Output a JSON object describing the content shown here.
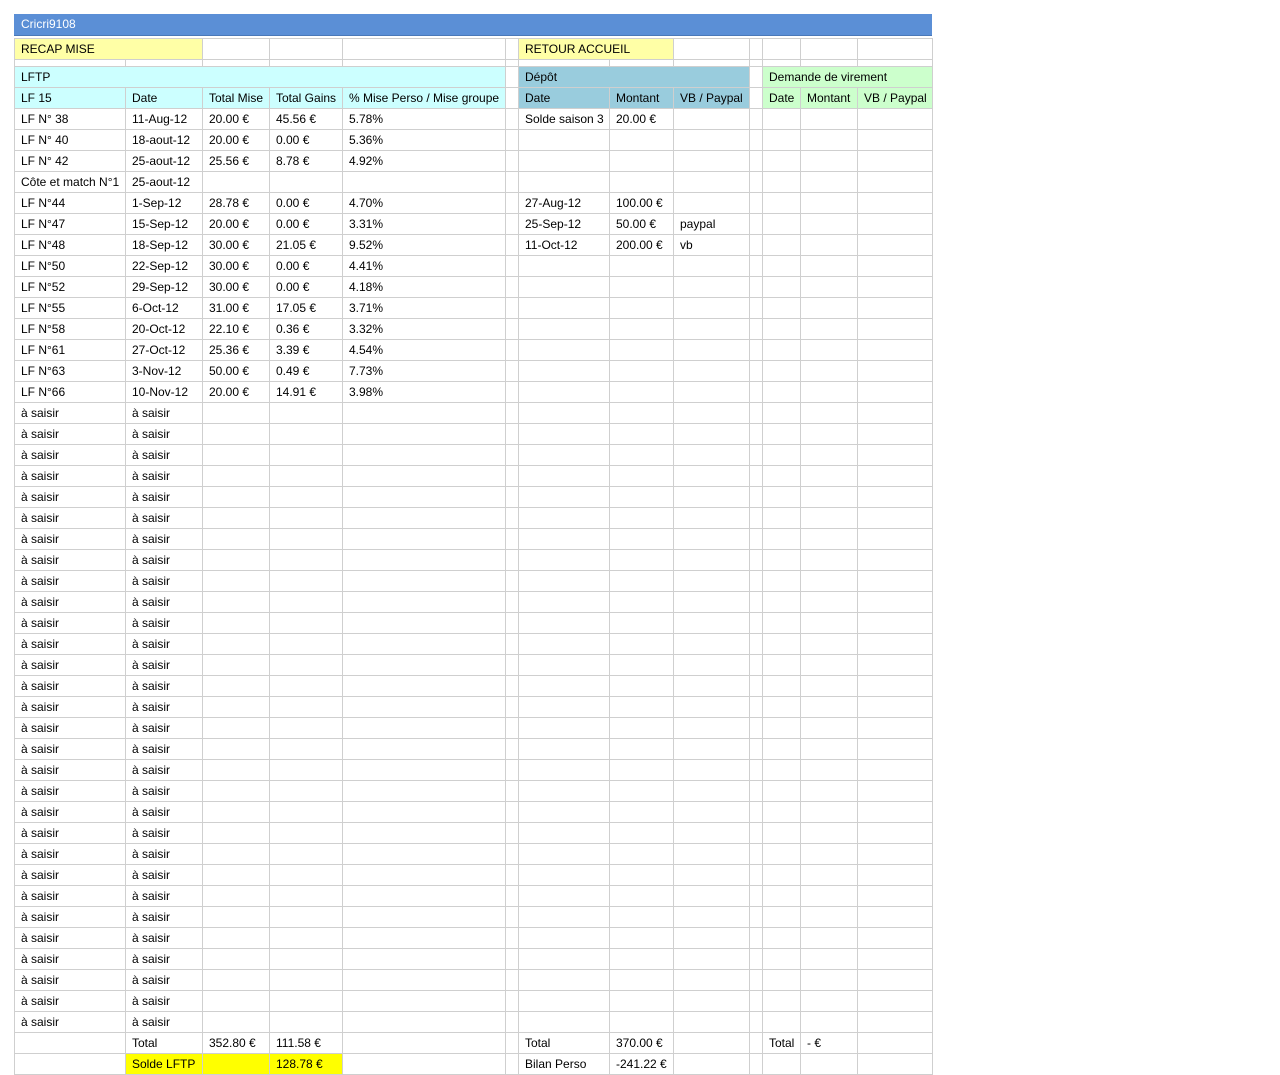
{
  "sheet_title": "Cricri9108",
  "buttons": {
    "recap": "RECAP MISE",
    "home": "RETOUR ACCUEIL"
  },
  "sections": {
    "lftp": "LFTP",
    "depot": "Dépôt",
    "virement": "Demande de virement"
  },
  "headers": {
    "lf": [
      "LF 15",
      "Date",
      "Total Mise",
      "Total Gains",
      "% Mise Perso / Mise groupe"
    ],
    "depot": [
      "Date",
      "Montant",
      "VB / Paypal"
    ],
    "virement": [
      "Date",
      "Montant",
      "VB / Paypal"
    ]
  },
  "rows": [
    {
      "lf": "LF N° 38",
      "date": "11-Aug-12",
      "mise": "20.00 €",
      "gains": "45.56 €",
      "pct": "5.78%",
      "d_date": "Solde saison 3",
      "d_montant": "20.00 €",
      "d_vb": ""
    },
    {
      "lf": "LF N° 40",
      "date": "18-aout-12",
      "mise": "20.00 €",
      "gains": "0.00 €",
      "pct": "5.36%",
      "d_date": "",
      "d_montant": "",
      "d_vb": ""
    },
    {
      "lf": "LF N° 42",
      "date": "25-aout-12",
      "mise": "25.56 €",
      "gains": "8.78 €",
      "pct": "4.92%",
      "d_date": "",
      "d_montant": "",
      "d_vb": ""
    },
    {
      "lf": "Côte et match N°1",
      "date": "25-aout-12",
      "mise": "",
      "gains": "",
      "pct": "",
      "d_date": "",
      "d_montant": "",
      "d_vb": ""
    },
    {
      "lf": "LF N°44",
      "date": "1-Sep-12",
      "mise": "28.78 €",
      "gains": "0.00 €",
      "pct": "4.70%",
      "d_date": "27-Aug-12",
      "d_montant": "100.00 €",
      "d_vb": ""
    },
    {
      "lf": "LF N°47",
      "date": "15-Sep-12",
      "mise": "20.00 €",
      "gains": "0.00 €",
      "pct": "3.31%",
      "d_date": "25-Sep-12",
      "d_montant": "50.00 €",
      "d_vb": "paypal"
    },
    {
      "lf": "LF N°48",
      "date": "18-Sep-12",
      "mise": "30.00 €",
      "gains": "21.05 €",
      "pct": "9.52%",
      "d_date": "11-Oct-12",
      "d_montant": "200.00 €",
      "d_vb": "vb"
    },
    {
      "lf": "LF N°50",
      "date": "22-Sep-12",
      "mise": "30.00 €",
      "gains": "0.00 €",
      "pct": "4.41%",
      "d_date": "",
      "d_montant": "",
      "d_vb": ""
    },
    {
      "lf": "LF N°52",
      "date": "29-Sep-12",
      "mise": "30.00 €",
      "gains": "0.00 €",
      "pct": "4.18%",
      "d_date": "",
      "d_montant": "",
      "d_vb": ""
    },
    {
      "lf": "LF N°55",
      "date": "6-Oct-12",
      "mise": "31.00 €",
      "gains": "17.05 €",
      "pct": "3.71%",
      "d_date": "",
      "d_montant": "",
      "d_vb": ""
    },
    {
      "lf": "LF N°58",
      "date": "20-Oct-12",
      "mise": "22.10 €",
      "gains": "0.36 €",
      "pct": "3.32%",
      "d_date": "",
      "d_montant": "",
      "d_vb": ""
    },
    {
      "lf": "LF N°61",
      "date": "27-Oct-12",
      "mise": "25.36 €",
      "gains": "3.39 €",
      "pct": "4.54%",
      "d_date": "",
      "d_montant": "",
      "d_vb": ""
    },
    {
      "lf": "LF N°63",
      "date": "3-Nov-12",
      "mise": "50.00 €",
      "gains": "0.49 €",
      "pct": "7.73%",
      "d_date": "",
      "d_montant": "",
      "d_vb": ""
    },
    {
      "lf": "LF N°66",
      "date": "10-Nov-12",
      "mise": "20.00 €",
      "gains": "14.91 €",
      "pct": "3.98%",
      "d_date": "",
      "d_montant": "",
      "d_vb": ""
    },
    {
      "lf": "à saisir",
      "date": "à saisir"
    },
    {
      "lf": "à saisir",
      "date": "à saisir"
    },
    {
      "lf": "à saisir",
      "date": "à saisir"
    },
    {
      "lf": "à saisir",
      "date": "à saisir"
    },
    {
      "lf": "à saisir",
      "date": "à saisir"
    },
    {
      "lf": "à saisir",
      "date": "à saisir"
    },
    {
      "lf": "à saisir",
      "date": "à saisir"
    },
    {
      "lf": "à saisir",
      "date": "à saisir"
    },
    {
      "lf": "à saisir",
      "date": "à saisir"
    },
    {
      "lf": "à saisir",
      "date": "à saisir"
    },
    {
      "lf": "à saisir",
      "date": "à saisir"
    },
    {
      "lf": "à saisir",
      "date": "à saisir"
    },
    {
      "lf": "à saisir",
      "date": "à saisir"
    },
    {
      "lf": "à saisir",
      "date": "à saisir"
    },
    {
      "lf": "à saisir",
      "date": "à saisir"
    },
    {
      "lf": "à saisir",
      "date": "à saisir"
    },
    {
      "lf": "à saisir",
      "date": "à saisir"
    },
    {
      "lf": "à saisir",
      "date": "à saisir"
    },
    {
      "lf": "à saisir",
      "date": "à saisir"
    },
    {
      "lf": "à saisir",
      "date": "à saisir"
    },
    {
      "lf": "à saisir",
      "date": "à saisir"
    },
    {
      "lf": "à saisir",
      "date": "à saisir"
    },
    {
      "lf": "à saisir",
      "date": "à saisir"
    },
    {
      "lf": "à saisir",
      "date": "à saisir"
    },
    {
      "lf": "à saisir",
      "date": "à saisir"
    },
    {
      "lf": "à saisir",
      "date": "à saisir"
    },
    {
      "lf": "à saisir",
      "date": "à saisir"
    },
    {
      "lf": "à saisir",
      "date": "à saisir"
    },
    {
      "lf": "à saisir",
      "date": "à saisir"
    },
    {
      "lf": "à saisir",
      "date": "à saisir"
    }
  ],
  "totals": {
    "label": "Total",
    "mise": "352.80 €",
    "gains": "111.58 €",
    "depot_label": "Total",
    "depot_montant": "370.00 €",
    "vir_label": "Total",
    "vir_montant": "- €"
  },
  "solde": {
    "label": "Solde LFTP",
    "value": "128.78 €",
    "bilan_label": "Bilan Perso",
    "bilan_value": "-241.22 €"
  }
}
